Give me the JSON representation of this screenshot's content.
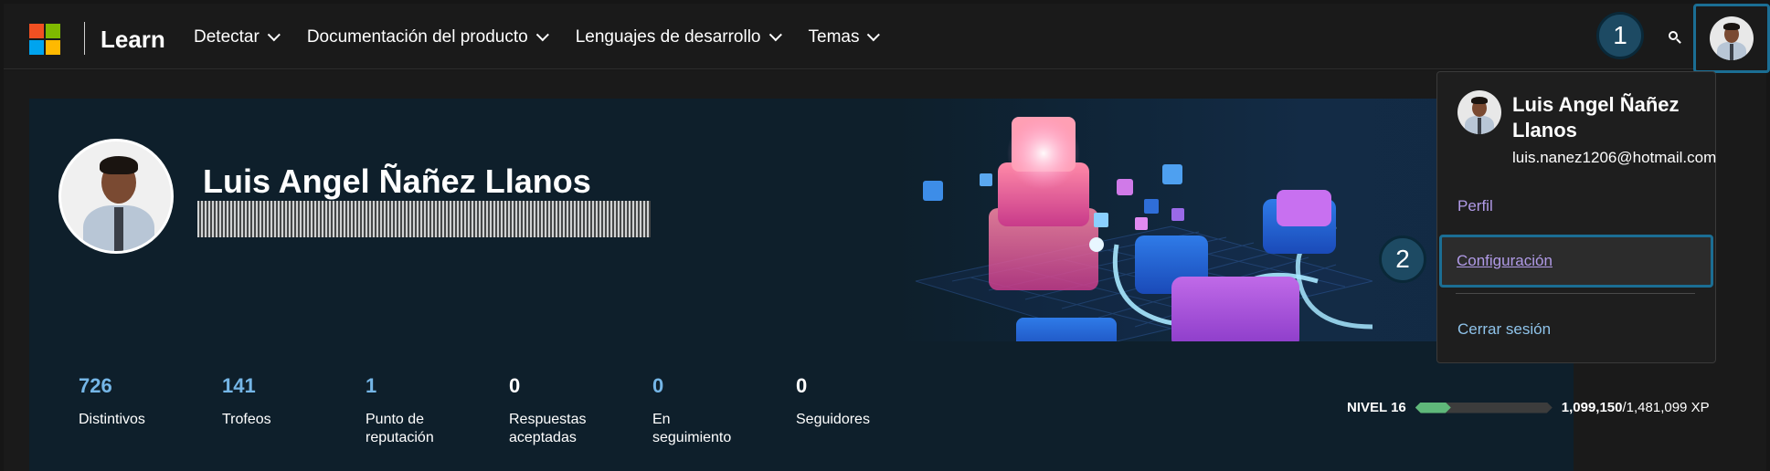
{
  "nav": {
    "brand": "Learn",
    "items": [
      {
        "label": "Detectar"
      },
      {
        "label": "Documentación del producto"
      },
      {
        "label": "Lenguajes de desarrollo"
      },
      {
        "label": "Temas"
      }
    ],
    "logo_colors": [
      "#f25022",
      "#7fba00",
      "#00a4ef",
      "#ffb900"
    ]
  },
  "callouts": {
    "first": "1",
    "second": "2"
  },
  "profile": {
    "name": "Luis Angel Ñañez Llanos",
    "stats": [
      {
        "value": "726",
        "label": "Distintivos",
        "highlight": true
      },
      {
        "value": "141",
        "label": "Trofeos",
        "highlight": true
      },
      {
        "value": "1",
        "label": "Punto de reputación",
        "highlight": true
      },
      {
        "value": "0",
        "label": "Respuestas aceptadas",
        "highlight": false
      },
      {
        "value": "0",
        "label": "En seguimiento",
        "highlight": true
      },
      {
        "value": "0",
        "label": "Seguidores",
        "highlight": false
      }
    ],
    "level": {
      "label": "NIVEL 16",
      "xp_current": "1,099,150",
      "xp_total": "/1,481,099 XP",
      "progress_fraction": 0.26
    }
  },
  "menu": {
    "name": "Luis Angel Ñañez Llanos",
    "email": "luis.nanez1206@hotmail.com",
    "profile_link": "Perfil",
    "settings_link": "Configuración",
    "logout_link": "Cerrar sesión"
  },
  "colors": {
    "accent_link": "#b09ae6",
    "stat_blue": "#75b6e7",
    "highlight_border": "#1b6e94",
    "level_green": "#5fb87a"
  }
}
